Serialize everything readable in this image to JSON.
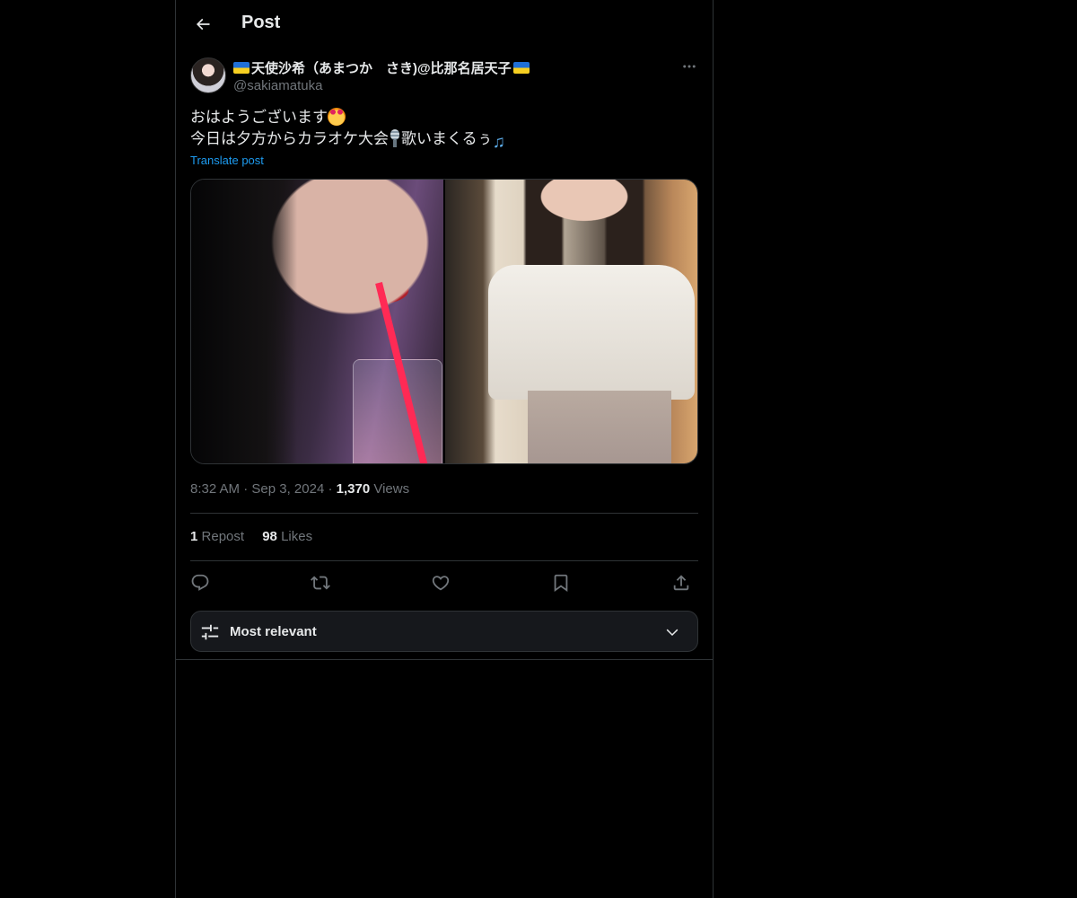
{
  "header": {
    "title": "Post",
    "back_icon": "arrow-left-icon"
  },
  "author": {
    "display_name": "天使沙希（あまつか　さき)@比那名居天子",
    "handle": "@sakiamatuka",
    "flag_icon": "ukraine-flag-icon",
    "more_icon": "more-horizontal-icon"
  },
  "post": {
    "line1": "おはようございます",
    "line2_part1": "今日は夕方からカラオケ大会",
    "line2_part2": "歌いまくるぅ",
    "translate_label": "Translate post",
    "emojis": [
      "smiling-face-with-hearts-icon",
      "microphone-icon",
      "musical-notes-icon"
    ]
  },
  "media": {
    "photos": [
      "photo-left",
      "photo-right"
    ]
  },
  "meta": {
    "time": "8:32 AM",
    "date": "Sep 3, 2024",
    "views_count": "1,370",
    "views_label": "Views",
    "separator": "·"
  },
  "stats": {
    "reposts_count": "1",
    "reposts_label": "Repost",
    "likes_count": "98",
    "likes_label": "Likes"
  },
  "actions": [
    "reply-icon",
    "repost-icon",
    "like-icon",
    "bookmark-icon",
    "share-icon"
  ],
  "sort": {
    "label": "Most relevant",
    "icon": "sliders-icon",
    "chevron": "chevron-down-icon"
  },
  "colors": {
    "background": "#000000",
    "text": "#e7e9ea",
    "muted": "#71767b",
    "link": "#1d9bf0",
    "border": "#2f3336"
  }
}
